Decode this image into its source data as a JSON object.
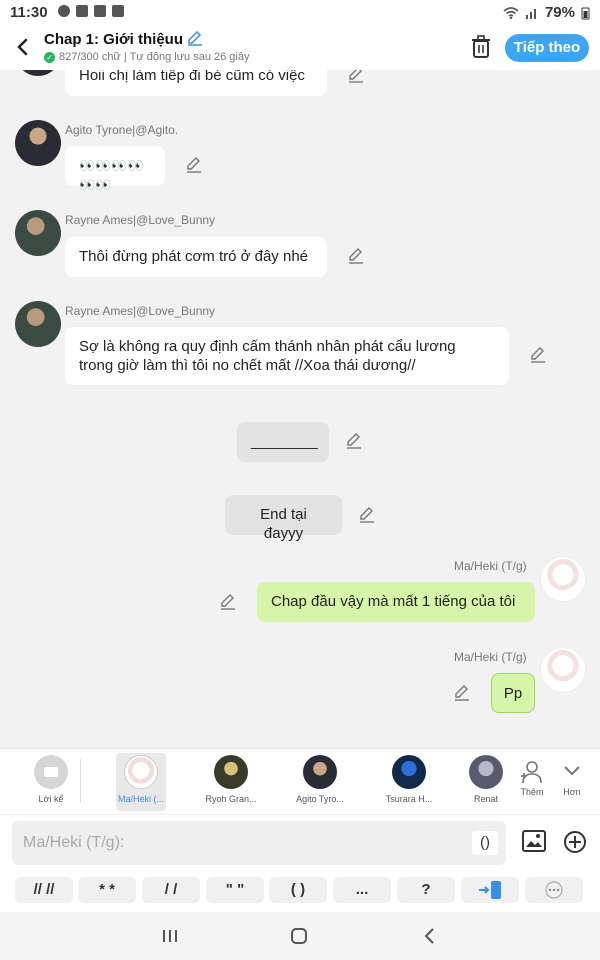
{
  "status": {
    "time": "11:30",
    "battery": "79%"
  },
  "header": {
    "title": "Chap 1: Giới thiệuu",
    "subtitle": "827/300 chữ | Tự động lưu sau 26 giây",
    "next_label": "Tiếp theo"
  },
  "messages": [
    {
      "text": "Hoii chị làm tiếp đi bé cũm có việc"
    },
    {
      "sender": "Agito Tyrone|@Agito.",
      "text": "👀👀👀👀👀👀"
    },
    {
      "sender": "Rayne Ames|@Love_Bunny",
      "text": "Thôi đừng phát cơm tró ở đây nhé"
    },
    {
      "sender": "Rayne Ames|@Love_Bunny",
      "text_line1": "Sợ là không ra quy định cấm thánh nhân phát cẩu lương",
      "text_line2": "trong giờ làm thì tôi no chết mất //Xoa thái dương//"
    },
    {
      "text": "________"
    },
    {
      "text": "End tại đayyy"
    },
    {
      "sender": "Ma/Heki (T/g)",
      "text": "Chap đầu vậy mà mất 1 tiếng của tôi"
    },
    {
      "sender": "Ma/Heki (T/g)",
      "text": "Pp"
    }
  ],
  "characters": [
    {
      "name": "Lời kể"
    },
    {
      "name": "Ma/Heki (..."
    },
    {
      "name": "Ryoh Gran..."
    },
    {
      "name": "Agito Tyro..."
    },
    {
      "name": "Tsurara H..."
    },
    {
      "name": "Renat"
    }
  ],
  "char_actions": {
    "add_label": "Thêm",
    "more_label": "Hơn"
  },
  "input": {
    "placeholder": "Ma/Heki (T/g):",
    "paren_label": "()"
  },
  "quick_symbols": [
    "// //",
    "* *",
    "/ /",
    "\" \"",
    "( )",
    "...",
    "?"
  ],
  "colors": {
    "accent": "#3ea4f5",
    "own_bubble": "#d7f5a9",
    "narration_bubble": "#e3e3e3"
  },
  "icons": [
    "back-arrow-icon",
    "edit-pencil-icon",
    "trash-icon",
    "image-icon",
    "plus-circle-icon",
    "add-person-icon",
    "chevron-down-icon",
    "recent-apps-icon",
    "home-icon",
    "back-nav-icon"
  ]
}
